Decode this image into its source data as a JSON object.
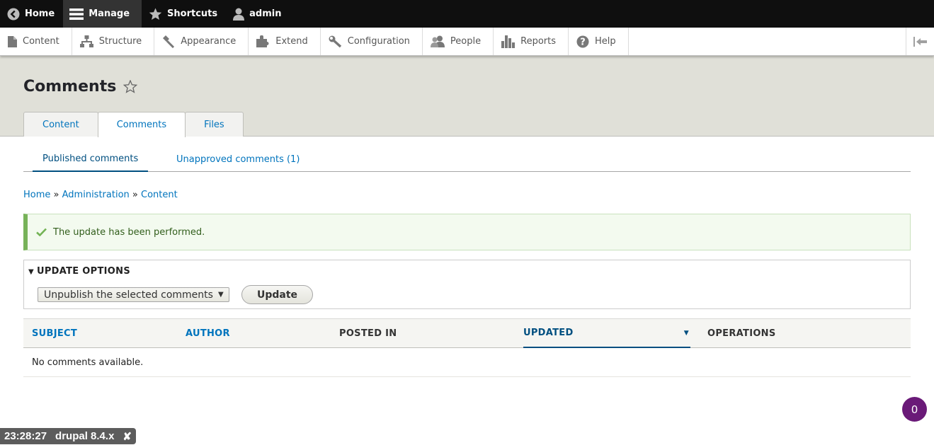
{
  "toolbar": {
    "home": "Home",
    "manage": "Manage",
    "shortcuts": "Shortcuts",
    "user": "admin"
  },
  "tray": {
    "items": [
      {
        "label": "Content",
        "icon": "file-icon"
      },
      {
        "label": "Structure",
        "icon": "structure-icon"
      },
      {
        "label": "Appearance",
        "icon": "paintbrush-icon"
      },
      {
        "label": "Extend",
        "icon": "puzzle-icon"
      },
      {
        "label": "Configuration",
        "icon": "wrench-icon"
      },
      {
        "label": "People",
        "icon": "people-icon"
      },
      {
        "label": "Reports",
        "icon": "bar-chart-icon"
      },
      {
        "label": "Help",
        "icon": "help-icon"
      }
    ]
  },
  "page": {
    "title": "Comments",
    "tabs": [
      "Content",
      "Comments",
      "Files"
    ],
    "active_tab": "Comments",
    "subtabs": [
      "Published comments",
      "Unapproved comments (1)"
    ],
    "active_subtab": "Published comments"
  },
  "breadcrumb": {
    "items": [
      "Home",
      "Administration",
      "Content"
    ],
    "separator": "»"
  },
  "message": {
    "text": "The update has been performed.",
    "status_color": "#77b259"
  },
  "update_options": {
    "summary": "UPDATE OPTIONS",
    "selected_action": "Unpublish the selected comments",
    "button_label": "Update"
  },
  "table": {
    "columns": [
      "SUBJECT",
      "AUTHOR",
      "POSTED IN",
      "UPDATED",
      "OPERATIONS"
    ],
    "empty_text": "No comments available."
  },
  "badge": {
    "count": "0"
  },
  "footer": {
    "time": "23:28:27",
    "site": "drupal 8.4.x",
    "close": "✘"
  },
  "colors": {
    "link": "#0074bd",
    "toolbar_bg": "#0f0f0f",
    "header_bg": "#e0e0d8",
    "badge_bg": "#6a1a78"
  }
}
